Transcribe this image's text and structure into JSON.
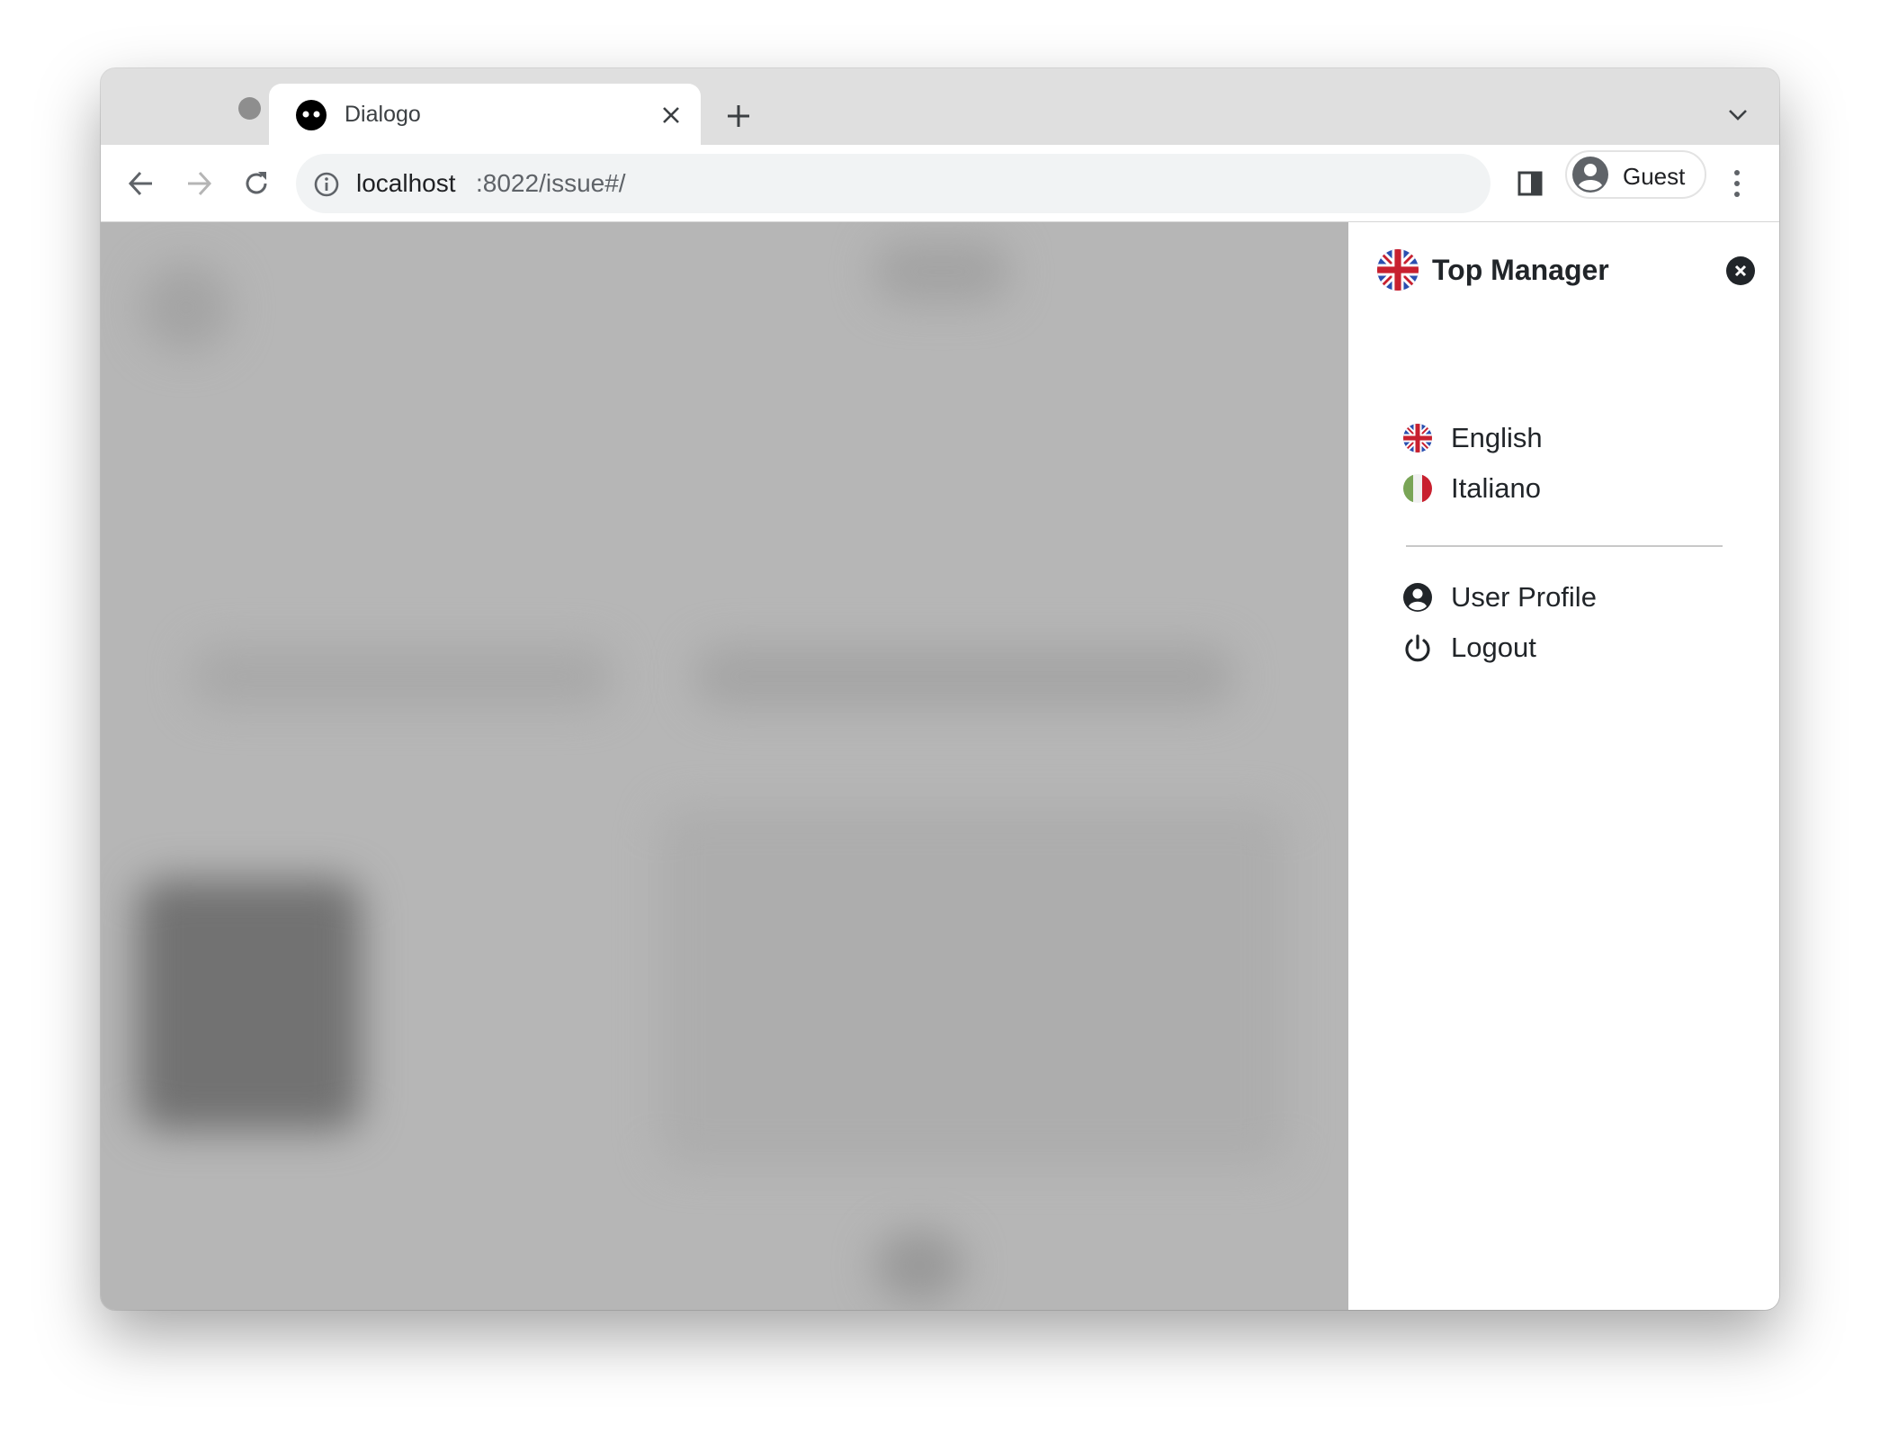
{
  "browser": {
    "tab": {
      "title": "Dialogo",
      "favicon": "dialogo-eyes-icon"
    },
    "address": {
      "host": "localhost",
      "rest": ":8022/issue#/"
    },
    "profile": {
      "label": "Guest"
    }
  },
  "drawer": {
    "title": "Top Manager",
    "languages": [
      {
        "label": "English",
        "icon": "uk-flag-icon"
      },
      {
        "label": "Italiano",
        "icon": "italy-flag-icon"
      }
    ],
    "actions": [
      {
        "label": "User Profile",
        "icon": "user-circle-icon"
      },
      {
        "label": "Logout",
        "icon": "power-icon"
      }
    ]
  },
  "colors": {
    "overlay": "#b6b6b6",
    "text": "#212529",
    "flag_red": "#c8202f",
    "flag_blue": "#2a4fb0",
    "flag_green": "#79a556"
  }
}
